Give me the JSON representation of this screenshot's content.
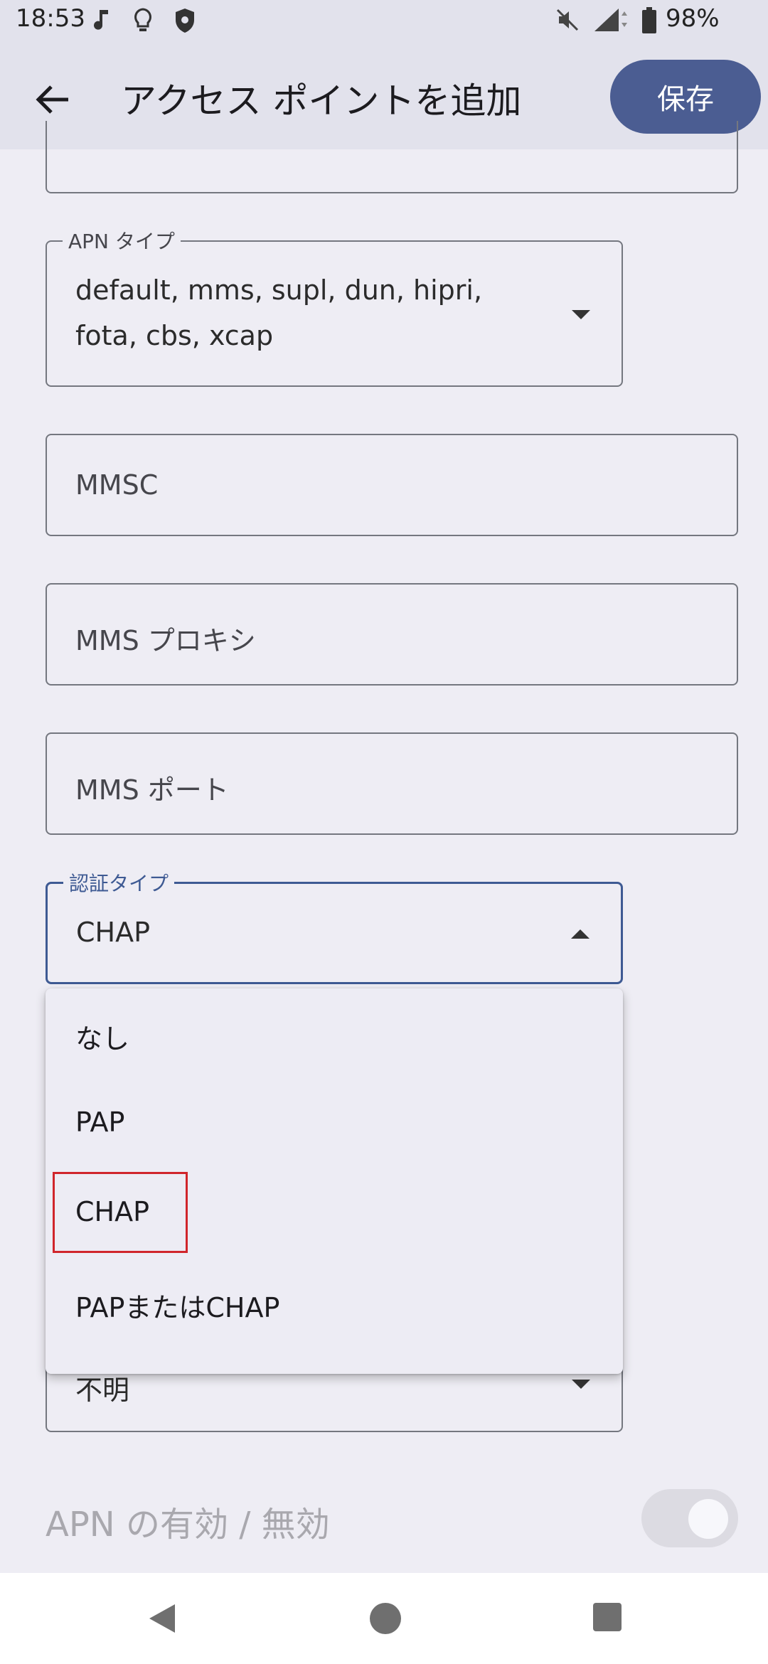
{
  "status_bar": {
    "time": "18:53",
    "battery": "98%"
  },
  "app_bar": {
    "title": "アクセス ポイントを追加",
    "save_label": "保存"
  },
  "fields": {
    "apn_type": {
      "legend": "APN タイプ",
      "value_line1": "default, mms, supl, dun, hipri,",
      "value_line2": "fota, cbs, xcap"
    },
    "mmsc": {
      "placeholder": "MMSC"
    },
    "mms_proxy": {
      "placeholder": "MMS プロキシ"
    },
    "mms_port": {
      "placeholder": "MMS ポート"
    },
    "auth_type": {
      "legend": "認証タイプ",
      "value": "CHAP"
    },
    "partial_bottom": {
      "value": "不明"
    }
  },
  "menu": {
    "items": [
      {
        "label": "なし"
      },
      {
        "label": "PAP"
      },
      {
        "label": "CHAP"
      },
      {
        "label": "PAPまたはCHAP"
      }
    ]
  },
  "apn_toggle": {
    "label": "APN の有効 / 無効",
    "enabled": true
  },
  "colors": {
    "accent": "#4b5d92",
    "background": "#eeedf4",
    "appbar": "#e2e2ec",
    "highlight": "#d0252b"
  },
  "icons": {
    "status": [
      "music-note-icon",
      "lightbulb-icon",
      "shield-icon",
      "mute-icon",
      "signal-icon",
      "battery-icon"
    ],
    "nav": [
      "nav-back-icon",
      "nav-home-icon",
      "nav-recents-icon"
    ]
  }
}
